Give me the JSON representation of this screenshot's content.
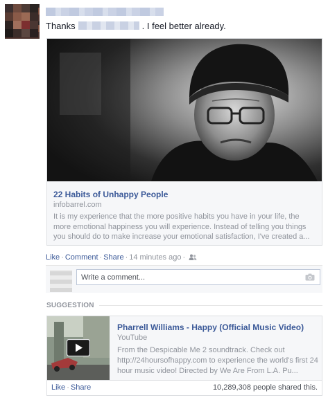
{
  "post": {
    "status_prefix": "Thanks",
    "status_suffix": ". I feel better already."
  },
  "attachment": {
    "title": "22 Habits of Unhappy People",
    "domain": "infobarrel.com",
    "description": "It is my experience that the more positive habits you have in your life, the more emotional happiness you will experience. Instead of telling you things you should do to make increase your emotional satisfaction, I've created a..."
  },
  "actions": {
    "like": "Like",
    "comment": "Comment",
    "share": "Share",
    "time": "14 minutes ago"
  },
  "comment": {
    "placeholder": "Write a comment..."
  },
  "suggestion": {
    "label": "SUGGESTION",
    "title": "Pharrell Williams - Happy (Official Music Video)",
    "source": "YouTube",
    "description": "From the Despicable Me 2 soundtrack. Check out http://24hoursofhappy.com to experience the world's first 24 hour music video! Directed by We Are From L.A. Pu...",
    "like": "Like",
    "share": "Share",
    "shared_count": "10,289,308 people shared this."
  },
  "icons": {
    "audience": "friends-icon",
    "camera": "camera-icon",
    "play": "play-icon"
  },
  "colors": {
    "link": "#3b5998",
    "meta": "#90949c"
  }
}
